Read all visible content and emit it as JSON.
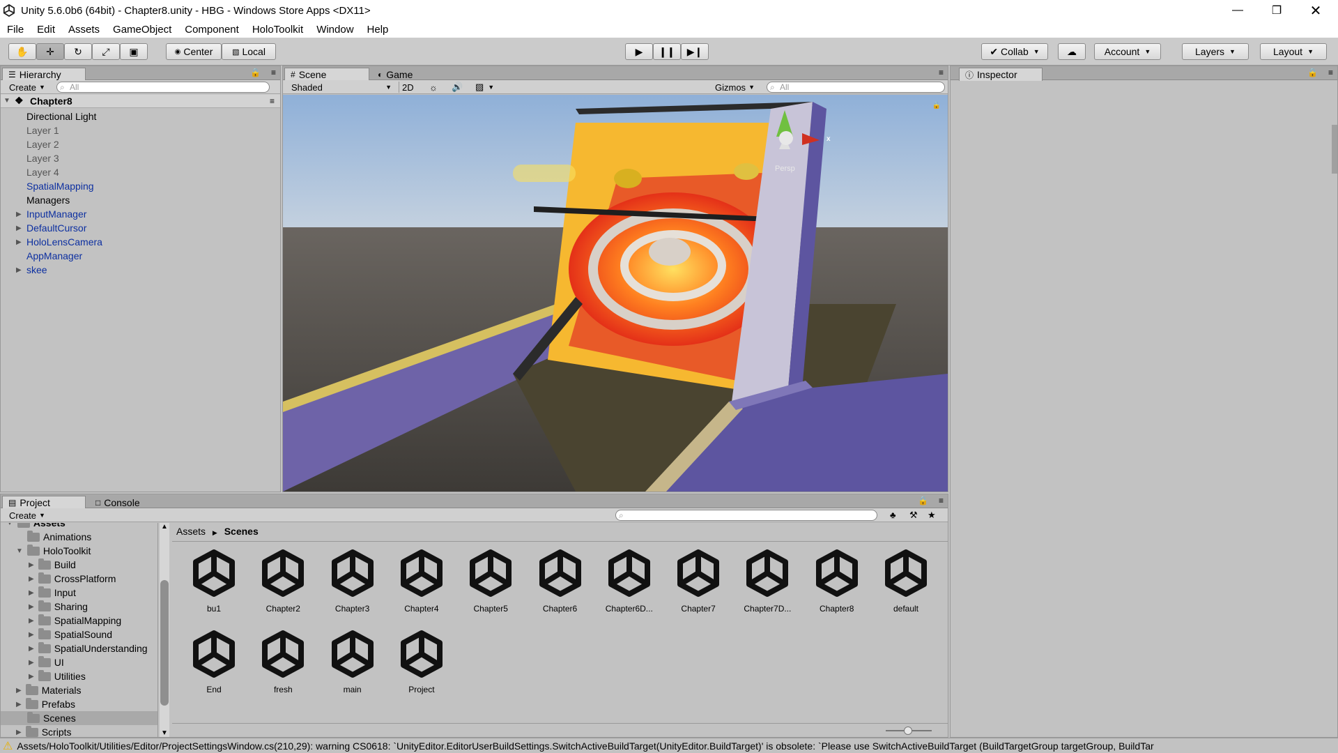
{
  "window": {
    "title": "Unity 5.6.0b6 (64bit) - Chapter8.unity - HBG - Windows Store Apps <DX11>"
  },
  "menu": [
    "File",
    "Edit",
    "Assets",
    "GameObject",
    "Component",
    "HoloToolkit",
    "Window",
    "Help"
  ],
  "toolbar": {
    "center_label": "Center",
    "local_label": "Local",
    "collab_label": "Collab",
    "account_label": "Account",
    "layers_label": "Layers",
    "layout_label": "Layout"
  },
  "hierarchy": {
    "tab": "Hierarchy",
    "create": "Create",
    "search_placeholder": "All",
    "scene": "Chapter8",
    "items": [
      {
        "label": "Directional Light"
      },
      {
        "label": "Layer 1"
      },
      {
        "label": "Layer 2"
      },
      {
        "label": "Layer 3"
      },
      {
        "label": "Layer 4"
      },
      {
        "label": "SpatialMapping"
      },
      {
        "label": "Managers"
      },
      {
        "label": "InputManager"
      },
      {
        "label": "DefaultCursor"
      },
      {
        "label": "HoloLensCamera"
      },
      {
        "label": "AppManager"
      },
      {
        "label": "skee"
      }
    ]
  },
  "scene_view": {
    "tab_scene": "Scene",
    "tab_game": "Game",
    "shading": "Shaded",
    "mode_2d": "2D",
    "gizmos": "Gizmos",
    "search_placeholder": "All",
    "gizmo_x": "x",
    "gizmo_persp": "Persp"
  },
  "inspector": {
    "tab": "Inspector"
  },
  "project": {
    "tab_project": "Project",
    "tab_console": "Console",
    "create": "Create",
    "tree": [
      {
        "label": "Assets"
      },
      {
        "label": "Animations"
      },
      {
        "label": "HoloToolkit"
      },
      {
        "label": "Build"
      },
      {
        "label": "CrossPlatform"
      },
      {
        "label": "Input"
      },
      {
        "label": "Sharing"
      },
      {
        "label": "SpatialMapping"
      },
      {
        "label": "SpatialSound"
      },
      {
        "label": "SpatialUnderstanding"
      },
      {
        "label": "UI"
      },
      {
        "label": "Utilities"
      },
      {
        "label": "Materials"
      },
      {
        "label": "Prefabs"
      },
      {
        "label": "Scenes"
      },
      {
        "label": "Scripts"
      }
    ],
    "breadcrumb": {
      "root": "Assets",
      "current": "Scenes"
    },
    "assets": [
      {
        "label": "bu1"
      },
      {
        "label": "Chapter2"
      },
      {
        "label": "Chapter3"
      },
      {
        "label": "Chapter4"
      },
      {
        "label": "Chapter5"
      },
      {
        "label": "Chapter6"
      },
      {
        "label": "Chapter6D..."
      },
      {
        "label": "Chapter7"
      },
      {
        "label": "Chapter7D..."
      },
      {
        "label": "Chapter8"
      },
      {
        "label": "default"
      },
      {
        "label": "End"
      },
      {
        "label": "fresh"
      },
      {
        "label": "main"
      },
      {
        "label": "Project"
      }
    ]
  },
  "status": {
    "message": "Assets/HoloToolkit/Utilities/Editor/ProjectSettingsWindow.cs(210,29): warning CS0618: `UnityEditor.EditorUserBuildSettings.SwitchActiveBuildTarget(UnityEditor.BuildTarget)' is obsolete: `Please use SwitchActiveBuildTarget (BuildTargetGroup targetGroup, BuildTar"
  },
  "colors": {
    "link_blue": "#0c2fa0",
    "panel_bg": "#c2c2c2",
    "selection": "#a9a9a9"
  }
}
